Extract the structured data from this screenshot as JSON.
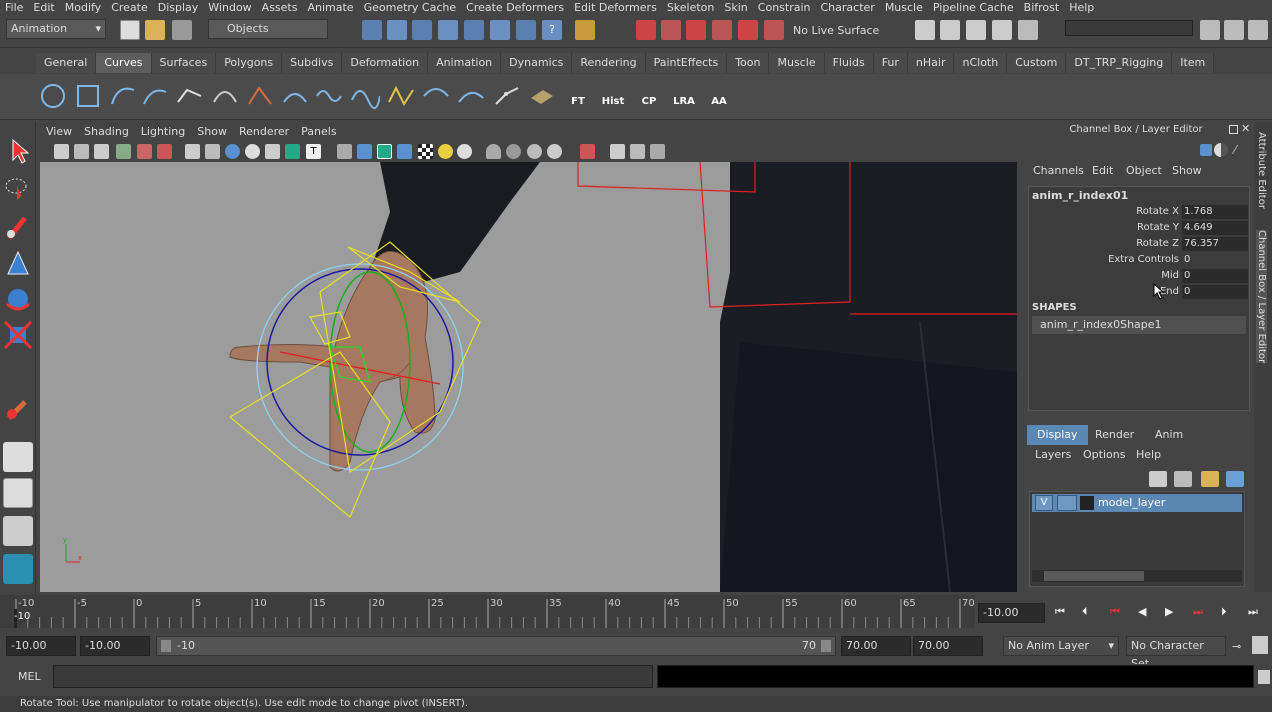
{
  "menubar": {
    "items": [
      "File",
      "Edit",
      "Modify",
      "Create",
      "Display",
      "Window",
      "Assets",
      "Animate",
      "Geometry Cache",
      "Create Deformers",
      "Edit Deformers",
      "Skeleton",
      "Skin",
      "Constrain",
      "Character",
      "Muscle",
      "Pipeline Cache",
      "Bifrost",
      "Help"
    ]
  },
  "status": {
    "mode": "Animation",
    "selection_mask": "Objects",
    "live_surface": "No Live Surface"
  },
  "shelf": {
    "tabs": [
      "General",
      "Curves",
      "Surfaces",
      "Polygons",
      "Subdivs",
      "Deformation",
      "Animation",
      "Dynamics",
      "Rendering",
      "PaintEffects",
      "Toon",
      "Muscle",
      "Fluids",
      "Fur",
      "nHair",
      "nCloth",
      "Custom",
      "DT_TRP_Rigging",
      "Item"
    ],
    "active_tab": "Curves",
    "buttons": [
      "FT",
      "Hist",
      "CP",
      "LRA",
      "AA"
    ]
  },
  "panel_menu": [
    "View",
    "Shading",
    "Lighting",
    "Show",
    "Renderer",
    "Panels"
  ],
  "channel_box": {
    "title": "Channel Box / Layer Editor",
    "menu": [
      "Channels",
      "Edit",
      "Object",
      "Show"
    ],
    "object": "anim_r_index01",
    "attrs": [
      {
        "name": "Rotate X",
        "value": "1.768"
      },
      {
        "name": "Rotate Y",
        "value": "4.649"
      },
      {
        "name": "Rotate Z",
        "value": "76.357"
      },
      {
        "name": "Extra Controls",
        "value": "0"
      },
      {
        "name": "Mid",
        "value": "0"
      },
      {
        "name": "End",
        "value": "0"
      }
    ],
    "shapes_label": "SHAPES",
    "shape": "anim_r_index0Shape1"
  },
  "layer_editor": {
    "tabs": [
      "Display",
      "Render",
      "Anim"
    ],
    "active_tab": "Display",
    "menu": [
      "Layers",
      "Options",
      "Help"
    ],
    "layer": {
      "visible": "V",
      "name": "model_layer"
    }
  },
  "side_tabs": [
    "Attribute Editor",
    "Channel Box / Layer Editor"
  ],
  "time_slider": {
    "ticks": [
      "-10",
      "-5",
      "0",
      "5",
      "10",
      "15",
      "20",
      "25",
      "30",
      "35",
      "40",
      "45",
      "50",
      "55",
      "60",
      "65",
      "70"
    ],
    "current": "-10",
    "current_field": "-10.00"
  },
  "range_slider": {
    "anim_start": "-10.00",
    "playback_start": "-10.00",
    "range_start_label": "-10",
    "range_end_label": "70",
    "playback_end": "70.00",
    "anim_end": "70.00",
    "anim_layer": "No Anim Layer",
    "character_set": "No Character Set"
  },
  "command_line": {
    "label": "MEL"
  },
  "help_line": "Rotate Tool: Use manipulator to rotate object(s). Use edit mode to change pivot (INSERT).",
  "colors": {
    "bg": "#444444",
    "viewport": "#9c9c9c",
    "active_tab": "#5d5d5d",
    "layer_row": "#5a87b4"
  }
}
